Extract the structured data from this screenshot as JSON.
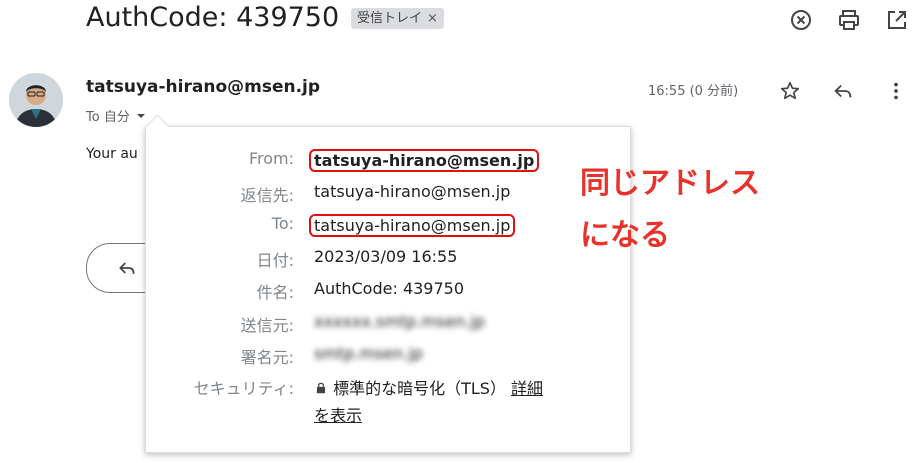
{
  "email": {
    "subject": "AuthCode: 439750",
    "label": "受信トレイ",
    "label_remove": "×",
    "sender": "tatsuya-hirano@msen.jp",
    "time": "16:55 (0 分前)",
    "to_line": "To 自分",
    "body_preview": "Your au"
  },
  "details": {
    "from_key": "From:",
    "from_val": "tatsuya-hirano@msen.jp",
    "replyto_key": "返信先:",
    "replyto_val": "tatsuya-hirano@msen.jp",
    "to_key": "To:",
    "to_val": "tatsuya-hirano@msen.jp",
    "date_key": "日付:",
    "date_val": "2023/03/09 16:55",
    "subject_key": "件名:",
    "subject_val": "AuthCode: 439750",
    "mailedby_key": "送信元:",
    "mailedby_val": "xxxxxx.smtp.msen.jp",
    "signedby_key": "署名元:",
    "signedby_val": "smtp.msen.jp",
    "security_key": "セキュリティ:",
    "security_val": "標準的な暗号化（TLS）",
    "security_link1": "詳細",
    "security_link2": "を表示"
  },
  "annotation": {
    "line1": "同じアドレス",
    "line2": "になる",
    "color": "#e8322b"
  },
  "icons": [
    "cancel-icon",
    "print-icon",
    "open-in-new-icon",
    "star-icon",
    "reply-icon",
    "more-vert-icon",
    "dropdown-icon",
    "lock-icon"
  ]
}
